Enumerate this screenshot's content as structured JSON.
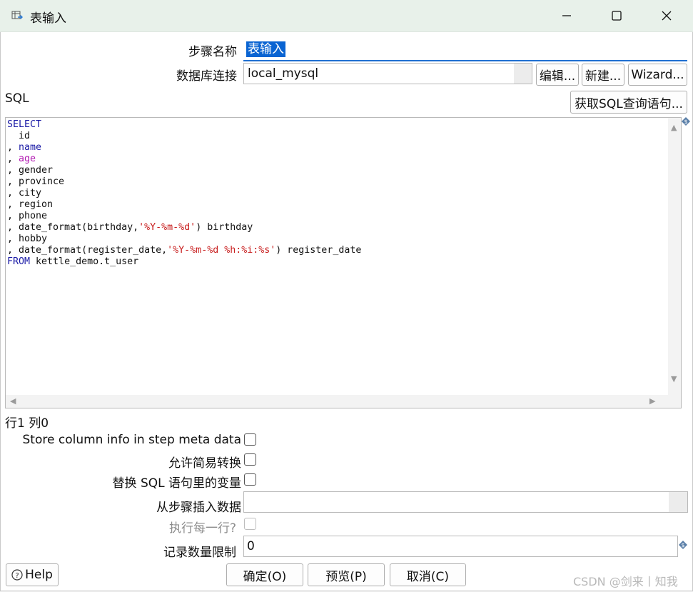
{
  "window": {
    "title": "表输入"
  },
  "form": {
    "step_name_label": "步骤名称",
    "step_name_value": "表输入",
    "db_conn_label": "数据库连接",
    "db_conn_value": "local_mysql",
    "edit_label": "编辑...",
    "new_label": "新建...",
    "wizard_label": "Wizard...",
    "sql_label": "SQL",
    "get_sql_label": "获取SQL查询语句...",
    "cursor_position": "行1 列0",
    "store_column_label": "Store column info in step meta data",
    "lazy_conversion_label": "允许简易转换",
    "replace_vars_label": "替换 SQL 语句里的变量",
    "insert_from_step_label": "从步骤插入数据",
    "insert_from_step_value": "",
    "execute_each_row_label": "执行每一行?",
    "limit_label": "记录数量限制",
    "limit_value": "0"
  },
  "sql": {
    "lines": [
      [
        {
          "t": "SELECT",
          "c": "kw"
        }
      ],
      [
        {
          "t": "  id",
          "c": ""
        }
      ],
      [
        {
          "t": ", ",
          "c": ""
        },
        {
          "t": "name",
          "c": "kw"
        }
      ],
      [
        {
          "t": ", ",
          "c": ""
        },
        {
          "t": "age",
          "c": "kw2"
        }
      ],
      [
        {
          "t": ", gender",
          "c": ""
        }
      ],
      [
        {
          "t": ", province",
          "c": ""
        }
      ],
      [
        {
          "t": ", city",
          "c": ""
        }
      ],
      [
        {
          "t": ", region",
          "c": ""
        }
      ],
      [
        {
          "t": ", phone",
          "c": ""
        }
      ],
      [
        {
          "t": ", date_format(birthday,",
          "c": ""
        },
        {
          "t": "'%Y-%m-%d'",
          "c": "str"
        },
        {
          "t": ") birthday",
          "c": ""
        }
      ],
      [
        {
          "t": ", hobby",
          "c": ""
        }
      ],
      [
        {
          "t": ", date_format(register_date,",
          "c": ""
        },
        {
          "t": "'%Y-%m-%d %h:%i:%s'",
          "c": "str"
        },
        {
          "t": ") register_date",
          "c": ""
        }
      ],
      [
        {
          "t": "FROM",
          "c": "kw"
        },
        {
          "t": " kettle_demo.t_user",
          "c": ""
        }
      ]
    ]
  },
  "buttons": {
    "help_label": "Help",
    "ok_label": "确定(O)",
    "preview_label": "预览(P)",
    "cancel_label": "取消(C)"
  },
  "watermark": "CSDN @剑来丨知我",
  "colors": {
    "selection": "#0a64d2",
    "keyword": "#1a1aa6",
    "keyword2": "#b21ab2",
    "string": "#c81e1e",
    "titlebar": "#e8f1ea"
  },
  "icons": {
    "title": "table-input-icon",
    "minimize": "minimize-icon",
    "maximize": "maximize-icon",
    "close": "close-icon",
    "help": "help-circle-icon",
    "variable": "variable-diamond-icon"
  }
}
